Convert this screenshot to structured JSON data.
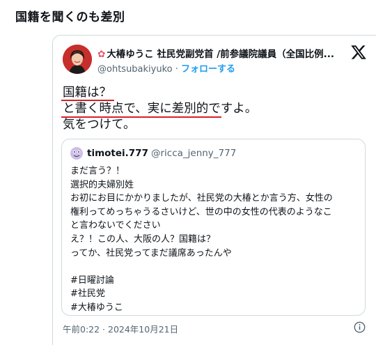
{
  "page_title": "国籍を聞くのも差別",
  "tweet": {
    "display_name_icon": "hibiscus-flower",
    "display_name": "大椿ゆうこ 社民党副党首 /前参議院議員（全国比例...",
    "handle": "@ohtsubakiyuko",
    "separator": "·",
    "follow_label": "フォローする",
    "text_lines": [
      "国籍は？",
      "と書く時点で、実に差別的ですよ。",
      "気をつけて。"
    ],
    "timestamp": "午前0:22 · 2024年10月21日"
  },
  "quote": {
    "display_name": "timotei.777",
    "handle": "@ricca_jenny_777",
    "body_lines": [
      "まだ言う？！",
      "選択的夫婦別姓",
      "お初にお目にかかりましたが、社民党の大椿とか言う方、女性の",
      "権利ってめっちゃうるさいけど、世の中の女性の代表のようなこ",
      "と言わないでください",
      "え？！この人、大阪の人？国籍は？",
      "ってか、社民党ってまだ議席あったんや",
      "",
      "#日曜討論",
      "#社民党",
      "#大椿ゆうこ"
    ]
  },
  "colors": {
    "link": "#1d9bf0",
    "underline": "#d6202b",
    "secondary_text": "#536471",
    "border": "#cfd9de"
  }
}
